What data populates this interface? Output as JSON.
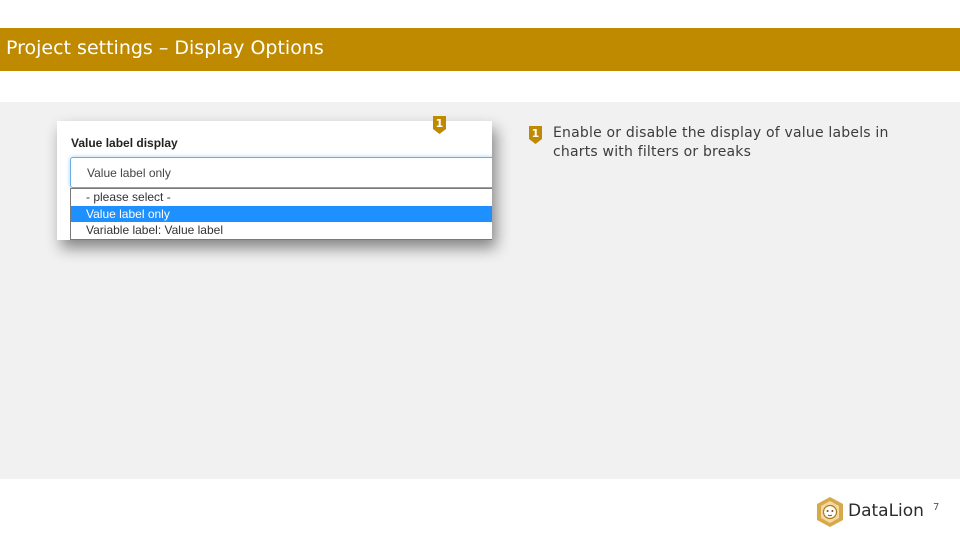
{
  "header": {
    "title": "Project settings – Display Options"
  },
  "screenshot": {
    "field_label": "Value label display",
    "selected_value": "Value label only",
    "options": [
      "- please select -",
      "Value label only",
      "Variable label: Value label"
    ]
  },
  "callouts": [
    {
      "number": "1",
      "text": "Enable or disable the display of value labels in charts with filters or breaks"
    }
  ],
  "footer": {
    "brand": "DataLion",
    "page_number": "7"
  },
  "colors": {
    "accent": "#bf8a00",
    "content_bg": "#f1f1f1",
    "selected_option": "#1e90ff"
  }
}
